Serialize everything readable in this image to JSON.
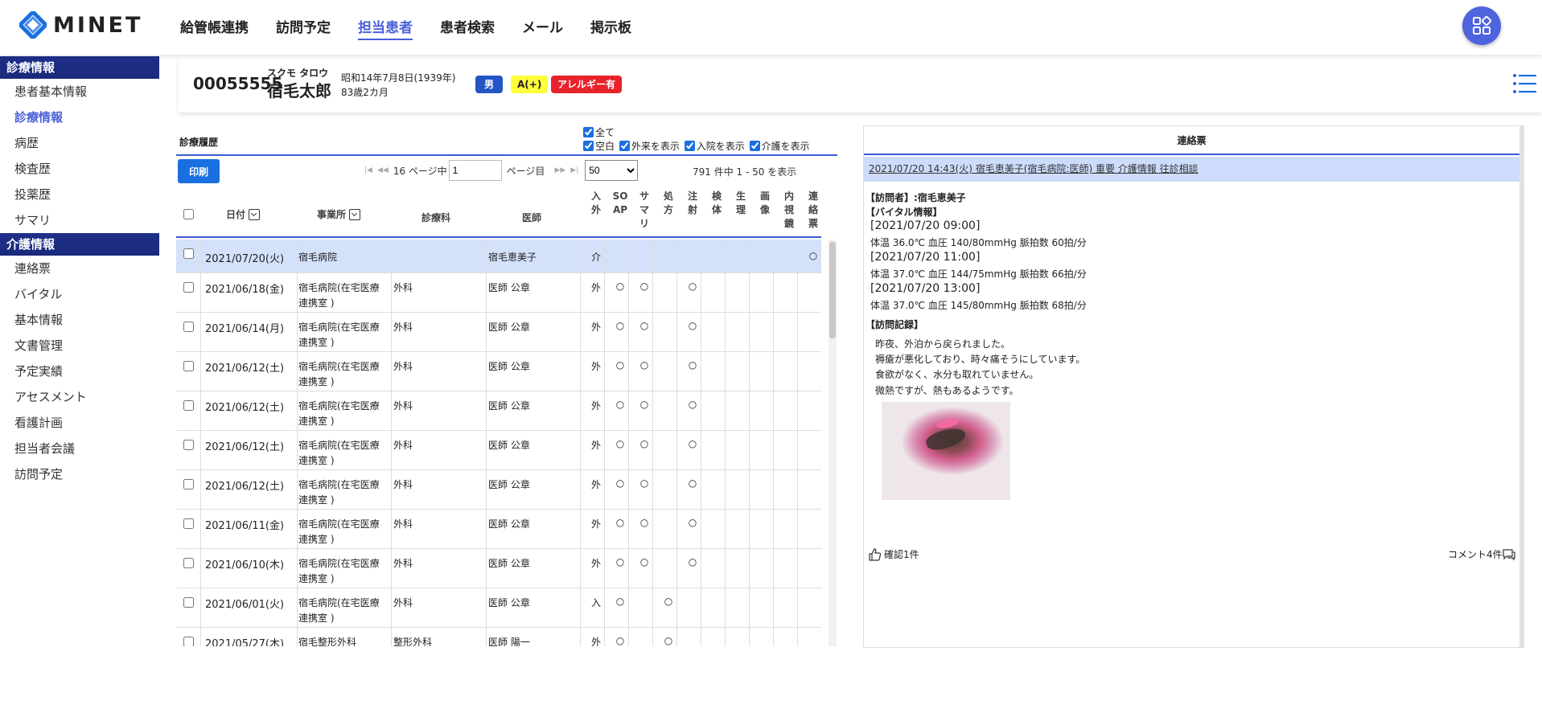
{
  "app": {
    "name": "MINET"
  },
  "nav": [
    "給管帳連携",
    "訪問予定",
    "担当患者",
    "患者検索",
    "メール",
    "掲示板"
  ],
  "sidebar": {
    "section1": {
      "title": "診療情報",
      "items": [
        "患者基本情報",
        "診療情報",
        "病歴",
        "検査歴",
        "投薬歴",
        "サマリ"
      ]
    },
    "section2": {
      "title": "介護情報",
      "items": [
        "連絡票",
        "バイタル",
        "基本情報",
        "文書管理",
        "予定実績",
        "アセスメント",
        "看護計画",
        "担当者会議",
        "訪問予定"
      ]
    }
  },
  "patient": {
    "id": "00055555",
    "kana": "スクモ タロウ",
    "name": "宿毛太郎",
    "dob": "昭和14年7月8日(1939年)",
    "age": "83歳2カ月",
    "sex": "男",
    "blood": "A(+)",
    "allergy": "アレルギー有"
  },
  "history": {
    "title": "診療履歴",
    "filters": {
      "all": "全て",
      "blank": "空白",
      "outpatient": "外来を表示",
      "inpatient": "入院を表示",
      "care": "介護を表示"
    },
    "print_label": "印刷",
    "pager": {
      "pages_prefix": "16 ページ中",
      "current_page": "1",
      "page_suffix": "ページ目",
      "per_page": "50"
    },
    "total": "791 件中 1 - 50 を表示",
    "columns": {
      "date": "日付",
      "office": "事業所",
      "dept": "診療科",
      "doctor": "医師",
      "flags": [
        "入外",
        "SOAP",
        "サマリ",
        "処方",
        "注射",
        "検体",
        "生理",
        "画像",
        "内視鏡",
        "連絡票"
      ]
    },
    "rows": [
      {
        "date": "2021/07/20(火)",
        "office1": "宿毛病院",
        "office2": "",
        "dept": "",
        "doctor": "宿毛恵美子",
        "io": "介",
        "marks": [
          "",
          "",
          "",
          "",
          "",
          "",
          "",
          "",
          "○"
        ]
      },
      {
        "date": "2021/06/18(金)",
        "office1": "宿毛病院(在宅医療",
        "office2": "連携室 )",
        "dept": "外科",
        "doctor": "医師 公章",
        "io": "外",
        "marks": [
          "○",
          "○",
          "",
          "○",
          "",
          "",
          "",
          "",
          ""
        ]
      },
      {
        "date": "2021/06/14(月)",
        "office1": "宿毛病院(在宅医療",
        "office2": "連携室 )",
        "dept": "外科",
        "doctor": "医師 公章",
        "io": "外",
        "marks": [
          "○",
          "○",
          "",
          "○",
          "",
          "",
          "",
          "",
          ""
        ]
      },
      {
        "date": "2021/06/12(土)",
        "office1": "宿毛病院(在宅医療",
        "office2": "連携室 )",
        "dept": "外科",
        "doctor": "医師 公章",
        "io": "外",
        "marks": [
          "○",
          "○",
          "",
          "○",
          "",
          "",
          "",
          "",
          ""
        ]
      },
      {
        "date": "2021/06/12(土)",
        "office1": "宿毛病院(在宅医療",
        "office2": "連携室 )",
        "dept": "外科",
        "doctor": "医師 公章",
        "io": "外",
        "marks": [
          "○",
          "○",
          "",
          "○",
          "",
          "",
          "",
          "",
          ""
        ]
      },
      {
        "date": "2021/06/12(土)",
        "office1": "宿毛病院(在宅医療",
        "office2": "連携室 )",
        "dept": "外科",
        "doctor": "医師 公章",
        "io": "外",
        "marks": [
          "○",
          "○",
          "",
          "○",
          "",
          "",
          "",
          "",
          ""
        ]
      },
      {
        "date": "2021/06/12(土)",
        "office1": "宿毛病院(在宅医療",
        "office2": "連携室 )",
        "dept": "外科",
        "doctor": "医師 公章",
        "io": "外",
        "marks": [
          "○",
          "○",
          "",
          "○",
          "",
          "",
          "",
          "",
          ""
        ]
      },
      {
        "date": "2021/06/11(金)",
        "office1": "宿毛病院(在宅医療",
        "office2": "連携室 )",
        "dept": "外科",
        "doctor": "医師 公章",
        "io": "外",
        "marks": [
          "○",
          "○",
          "",
          "○",
          "",
          "",
          "",
          "",
          ""
        ]
      },
      {
        "date": "2021/06/10(木)",
        "office1": "宿毛病院(在宅医療",
        "office2": "連携室 )",
        "dept": "外科",
        "doctor": "医師 公章",
        "io": "外",
        "marks": [
          "○",
          "○",
          "",
          "○",
          "",
          "",
          "",
          "",
          ""
        ]
      },
      {
        "date": "2021/06/01(火)",
        "office1": "宿毛病院(在宅医療",
        "office2": "連携室 )",
        "dept": "外科",
        "doctor": "医師 公章",
        "io": "入",
        "marks": [
          "○",
          "",
          "○",
          "",
          "",
          "",
          "",
          "",
          ""
        ]
      },
      {
        "date": "2021/05/27(木)",
        "office1": "宿毛整形外科",
        "office2": "",
        "dept": "整形外科",
        "doctor": "医師 陽一",
        "io": "外",
        "marks": [
          "○",
          "",
          "○",
          "",
          "",
          "",
          "",
          "",
          ""
        ]
      }
    ]
  },
  "contact": {
    "title": "連絡票",
    "note_header": "2021/07/20 14:43(火) 宿毛恵美子(宿毛病院:医師) 重要 介護情報 往診相談",
    "visitor": "【訪問者】:宿毛恵美子",
    "vitals_title": "【バイタル情報】",
    "vitals": [
      {
        "time": "[2021/07/20 09:00]",
        "values": "体温 36.0℃ 血圧 140/80mmHg 脈拍数 60拍/分"
      },
      {
        "time": "[2021/07/20 11:00]",
        "values": "体温 37.0℃ 血圧 144/75mmHg 脈拍数 66拍/分"
      },
      {
        "time": "[2021/07/20 13:00]",
        "values": "体温 37.0℃ 血圧 145/80mmHg 脈拍数 68拍/分"
      }
    ],
    "record_title": "【訪問記録】",
    "record": [
      "昨夜、外泊から戻られました。",
      "褥瘡が悪化しており、時々痛そうにしています。",
      "食欲がなく、水分も取れていません。",
      "微熱ですが、熱もあるようです。"
    ],
    "confirm": "確認1件",
    "comments": "コメント4件"
  }
}
